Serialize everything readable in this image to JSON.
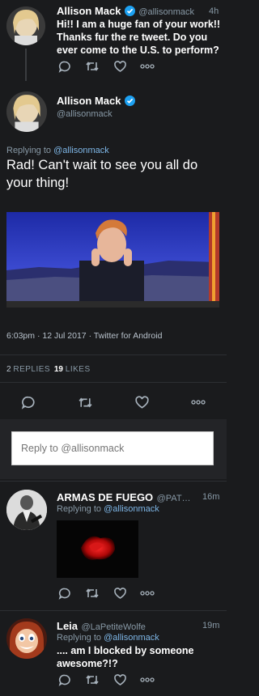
{
  "tweet1": {
    "name": "Allison Mack",
    "handle": "@allisonmack",
    "time": "4h",
    "text": "Hi!! I am a huge fan of your work!! Thanks fur the re tweet. Do you ever come to the U.S. to perform?",
    "icons": [
      "reply-icon",
      "retweet-icon",
      "heart-icon",
      "more-icon"
    ]
  },
  "main": {
    "name": "Allison Mack",
    "handle": "@allisonmack",
    "replying_prefix": "Replying to",
    "replying_to": "@allisonmack",
    "text": "Rad! Can't wait to see you all do your thing!",
    "timestamp": "6:03pm · 12 Jul 2017 · Twitter for Android",
    "replies_count": "2",
    "replies_label": "REPLIES",
    "likes_count": "19",
    "likes_label": "LIKES"
  },
  "reply_box": {
    "placeholder": "Reply to @allisonmack"
  },
  "tweet2": {
    "name": "ARMAS DE FUEGO",
    "handle": "@PAT…",
    "time": "16m",
    "replying_prefix": "Replying to",
    "replying_to": "@allisonmack"
  },
  "tweet3": {
    "name": "Leia",
    "handle": "@LaPetiteWolfe",
    "time": "19m",
    "replying_prefix": "Replying to",
    "replying_to": "@allisonmack",
    "text": ".... am I blocked by someone awesome?!?"
  },
  "colors": {
    "background": "#1a1b1d",
    "link": "#7eb6e6",
    "verified": "#1da1f2"
  }
}
